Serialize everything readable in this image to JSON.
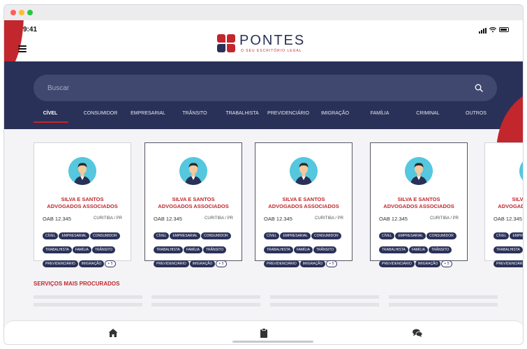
{
  "status": {
    "time": "9:41"
  },
  "brand": {
    "name": "PONTES",
    "tagline": "O SEU ESCRITÓRIO LEGAL"
  },
  "search": {
    "placeholder": "Buscar"
  },
  "tabs": [
    {
      "label": "CÍVEL",
      "active": true
    },
    {
      "label": "CONSUMIDOR"
    },
    {
      "label": "EMPRESARIAL"
    },
    {
      "label": "TRÂNSITO"
    },
    {
      "label": "TRABALHISTA"
    },
    {
      "label": "PREVIDENCIÁRIO"
    },
    {
      "label": "IMIGRAÇÃO"
    },
    {
      "label": "FAMÍLIA"
    },
    {
      "label": "CRIMINAL"
    },
    {
      "label": "OUTROS"
    }
  ],
  "cards": [
    {
      "name_line1": "SILVA E SANTOS",
      "name_line2": "ADVOGADOS ASSOCIADOS",
      "oab": "OAB 12.345",
      "city": "CURITIBA / PR",
      "tags": [
        "CÍVEL",
        "EMPRESARIAL",
        "CONSUMIDOR",
        "TRABALHISTA",
        "FAMÍLIA",
        "TRÂNSITO",
        "PREVIDENCIÁRIO",
        "IMIGRAÇÃO"
      ],
      "more": "+ 5"
    }
  ],
  "section": {
    "title": "SERVIÇOS MAIS PROCURADOS"
  },
  "colors": {
    "navy": "#2a3158",
    "red": "#c1272d",
    "avatar_bg": "#55c7de"
  },
  "bottom_nav": {
    "icons": [
      "home-icon",
      "clipboard-icon",
      "chat-icon"
    ]
  }
}
